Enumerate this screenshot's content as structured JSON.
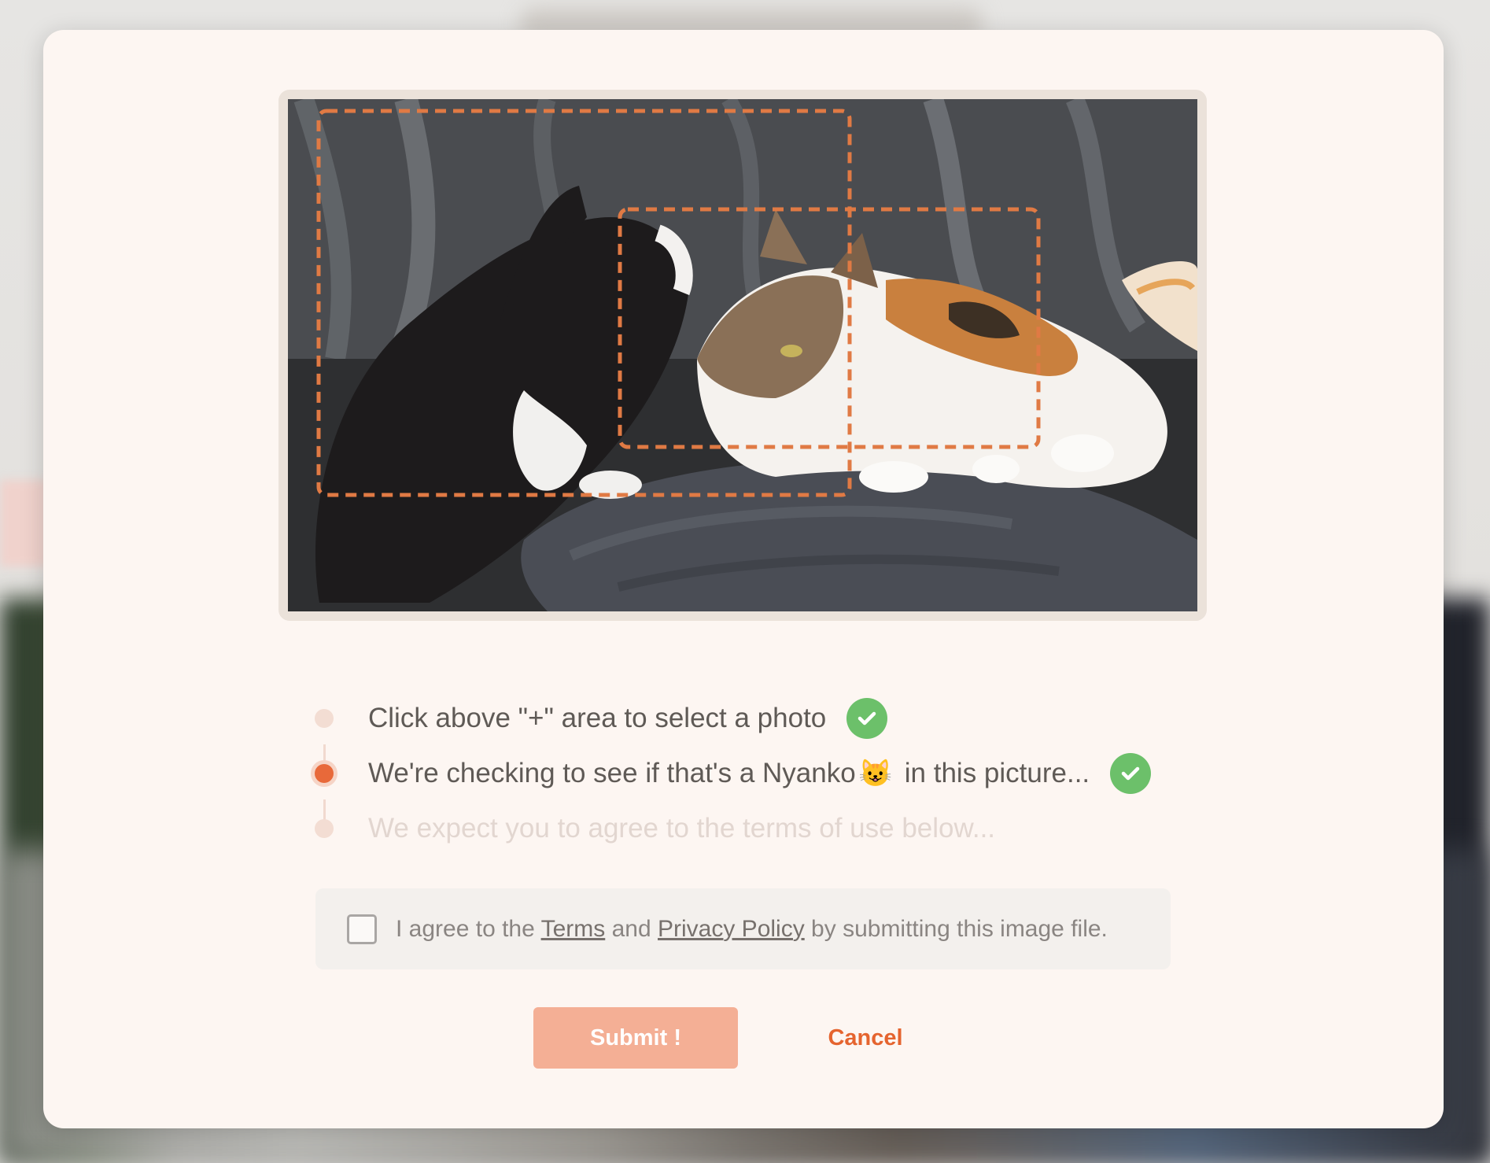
{
  "steps": [
    {
      "text": "Click above \"+\" area to select a photo",
      "status": "done"
    },
    {
      "text_before": "We're checking to see if that's a Nyanko",
      "emoji": "😺",
      "text_after": " in this picture...",
      "status": "done"
    },
    {
      "text": "We expect you to agree to the terms of use below...",
      "status": "pending"
    }
  ],
  "agreement": {
    "prefix": "I agree to the ",
    "terms_link": "Terms",
    "middle": " and ",
    "privacy_link": "Privacy Policy",
    "suffix": " by submitting this image file.",
    "checked": false
  },
  "actions": {
    "submit_label": "Submit !",
    "cancel_label": "Cancel"
  },
  "colors": {
    "accent": "#e8693a",
    "success": "#6cc06a",
    "submit_bg": "#f4af95",
    "modal_bg": "#fdf6f2"
  },
  "icons": [
    "check-icon",
    "cat-emoji"
  ]
}
